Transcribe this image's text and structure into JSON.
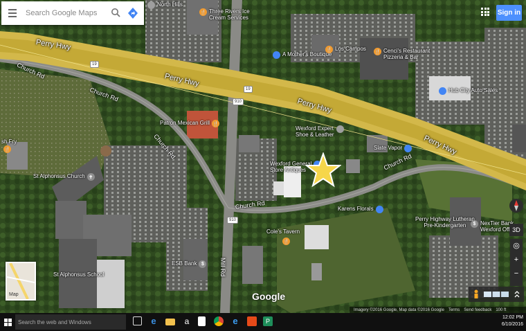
{
  "search": {
    "placeholder": "Search Google Maps"
  },
  "header": {
    "signin_label": "Sign in"
  },
  "roads": {
    "perry_hwy_1": "Perry Hwy",
    "perry_hwy_2": "Perry Hwy",
    "perry_hwy_3": "Perry Hwy",
    "perry_hwy_4": "Perry Hwy",
    "church_rd_1": "Church Rd",
    "church_rd_2": "Church Rd",
    "church_rd_3": "Church Rd",
    "church_rd_4": "Church Rd",
    "church_rd_5": "Church Rd",
    "mill_rd": "Mill Rd",
    "shield_19_a": "19",
    "shield_19_b": "19",
    "shield_910_a": "910",
    "shield_910_b": "910"
  },
  "places": {
    "north_hills": "North Hills",
    "three_rivers_1": "Three Rivers Ice",
    "three_rivers_2": "Cream Services",
    "mothers_boutique": "A Mother's Boutique",
    "los_campos": "Los Campos",
    "cencis_1": "Cenci's Restaurant",
    "cencis_2": "Pizzeria & Bar",
    "hub_city": "Hub City Auto Sales",
    "patron_mexican": "Patron Mexican Grill",
    "wexford_expert_1": "Wexford Expert",
    "wexford_expert_2": "Shoe & Leather",
    "slate_vapor": "Slate Vapor",
    "wexford_general_1": "Wexford General",
    "wexford_general_2": "Store Antiques",
    "fry": "sh Fry",
    "st_alphonsus_church": "St Alphonsus Church",
    "karens_florals": "Karens Florals",
    "perry_lutheran_1": "Perry Highway Lutheran",
    "perry_lutheran_2": "Pre-Kindergarten",
    "nextier_1": "NexTier Bank",
    "nextier_2": "Wexford Office",
    "coles_tavern": "Cole's Tavern",
    "esb_bank": "ESB Bank",
    "st_alphonsus_school": "St Alphonsus School"
  },
  "map": {
    "thumb_label": "Map",
    "google_logo": "Google",
    "footer": [
      "Imagery ©2016 Google, Map data ©2016 Google",
      "Terms",
      "Send feedback",
      "100 ft"
    ],
    "toggle_3d": "3D",
    "zoom_in": "+",
    "zoom_out": "−"
  },
  "taskbar": {
    "search_placeholder": "Search the web and Windows",
    "time": "12:02 PM",
    "date": "6/10/2016"
  }
}
